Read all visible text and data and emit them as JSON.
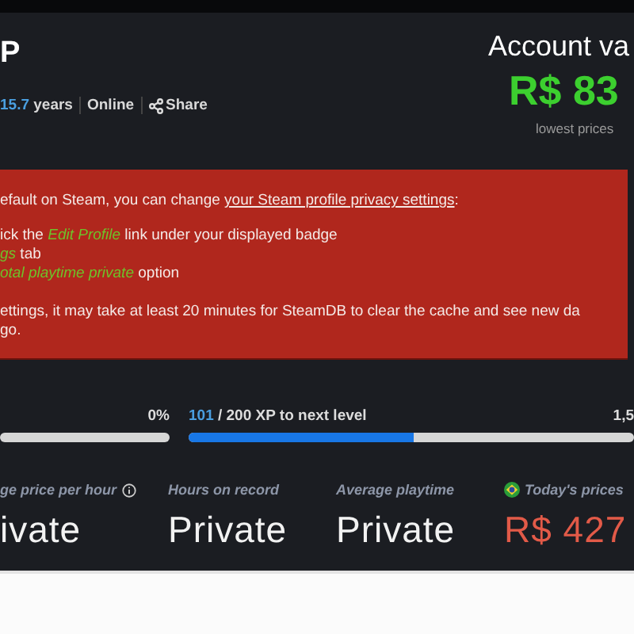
{
  "profile": {
    "name": "P",
    "meta": [
      {
        "kind": "age",
        "value": "15.7",
        "text": "years"
      },
      {
        "kind": "status",
        "text": "Online"
      },
      {
        "kind": "share",
        "text": "Share"
      }
    ]
  },
  "account": {
    "title": "Account va",
    "value": "R$ 83",
    "note": "lowest prices"
  },
  "notice": {
    "intro": {
      "text": "efault on Steam, you can change ",
      "link": "your Steam profile privacy settings",
      "after": ":"
    },
    "steps": [
      "ick the *Edit Profile* link under your displayed badge",
      "*gs* tab",
      "*otal playtime private* option"
    ],
    "outro": [
      "ettings, it may take at least 20 minutes for SteamDB to clear the cache and see new da",
      "go."
    ]
  },
  "progress": [
    {
      "kind": "percent",
      "reading": "0%",
      "level": 0
    },
    {
      "kind": "xp",
      "current": "101",
      "label": "/ 200 XP to next level",
      "reading": "1,5",
      "level": 0.505
    }
  ],
  "stats": [
    {
      "label": "ge price per hour",
      "value": "ivate",
      "kind": "info"
    },
    {
      "label": "Hours on record",
      "value": "Private",
      "kind": "plain"
    },
    {
      "label": "Average playtime",
      "value": "Private",
      "kind": "plain"
    },
    {
      "label": "Today's prices",
      "value": "R$ 427",
      "kind": "price"
    }
  ]
}
